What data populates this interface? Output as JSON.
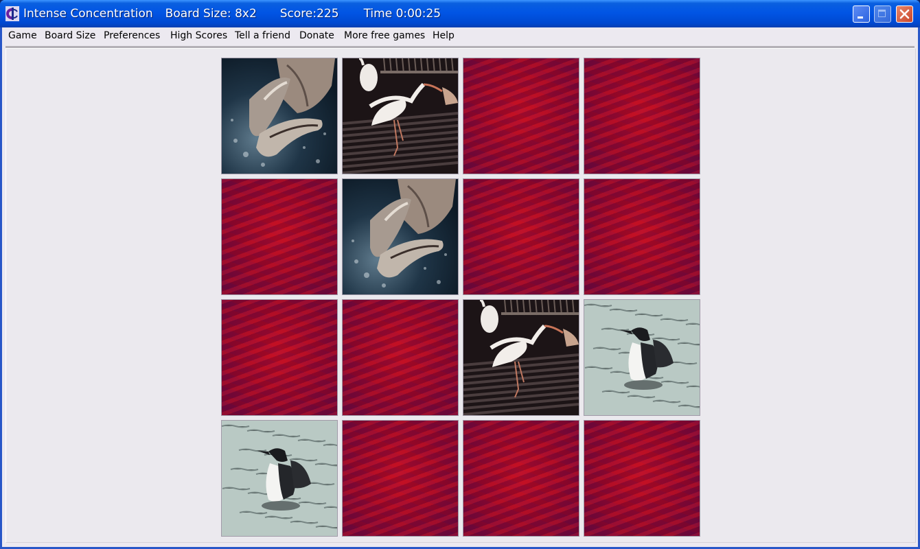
{
  "window": {
    "title": "Intense Concentration",
    "board_size_label": "Board Size: 8x2",
    "score_label": "Score:225",
    "time_label": "Time 0:00:25",
    "controls": {
      "minimize": "minimize",
      "maximize": "maximize",
      "close": "close"
    }
  },
  "menu": {
    "items": [
      {
        "label": "Game"
      },
      {
        "label": "Board Size"
      },
      {
        "label": "Preferences"
      },
      {
        "label": "High Scores"
      },
      {
        "label": "Tell a friend"
      },
      {
        "label": "Donate"
      },
      {
        "label": "More free games"
      },
      {
        "label": "Help"
      }
    ]
  },
  "game": {
    "board_size": "8x2",
    "score": 225,
    "time": "0:00:25",
    "rows": 4,
    "cols": 4,
    "card_back_color": "#a30a2c",
    "tiles": [
      {
        "state": "face-up",
        "picture": "dolphin"
      },
      {
        "state": "face-up",
        "picture": "ibis"
      },
      {
        "state": "face-down",
        "picture": null
      },
      {
        "state": "face-down",
        "picture": null
      },
      {
        "state": "face-down",
        "picture": null
      },
      {
        "state": "face-up",
        "picture": "dolphin"
      },
      {
        "state": "face-down",
        "picture": null
      },
      {
        "state": "face-down",
        "picture": null
      },
      {
        "state": "face-down",
        "picture": null
      },
      {
        "state": "face-down",
        "picture": null
      },
      {
        "state": "face-up",
        "picture": "ibis"
      },
      {
        "state": "face-up",
        "picture": "loon"
      },
      {
        "state": "face-up",
        "picture": "loon"
      },
      {
        "state": "face-down",
        "picture": null
      },
      {
        "state": "face-down",
        "picture": null
      },
      {
        "state": "face-down",
        "picture": null
      }
    ]
  }
}
